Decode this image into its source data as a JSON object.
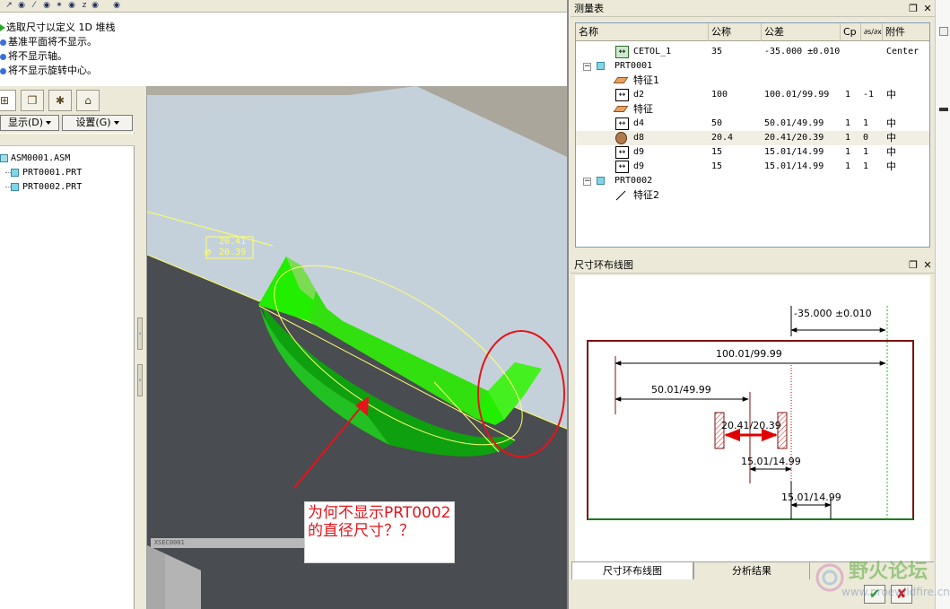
{
  "messages": [
    {
      "text": "选取尺寸以定义 1D 堆栈",
      "marker": "arrow"
    },
    {
      "text": "基准平面将不显示。",
      "marker": "bullet"
    },
    {
      "text": "将不显示轴。",
      "marker": "bullet"
    },
    {
      "text": "将不显示旋转中心。",
      "marker": "bullet"
    }
  ],
  "model_tree": {
    "show_menu": "显示(D)",
    "settings_menu": "设置(G)",
    "nodes": [
      "ASM0001.ASM",
      "PRT0001.PRT",
      "PRT0002.PRT"
    ]
  },
  "viewport": {
    "dim_upper": "20.41",
    "dim_lower": "20.39",
    "xsec_label": "XSEC0001",
    "note_text": "为何不显示PRT0002的直径尺寸？？"
  },
  "measure_table": {
    "title": "测量表",
    "columns": [
      "名称",
      "公称",
      "公差",
      "Cp",
      "∂s/∂x",
      "附件"
    ],
    "rows": [
      {
        "name": "CETOL_1",
        "nominal": "35",
        "tol": "-35.000 ±0.010",
        "cp": "",
        "sens": "",
        "attach": "Center",
        "icon": "dim-green",
        "indent": 1
      },
      {
        "name": "PRT0001",
        "nominal": "",
        "tol": "",
        "cp": "",
        "sens": "",
        "attach": "",
        "icon": "part",
        "indent": 0
      },
      {
        "name": "特征1",
        "nominal": "",
        "tol": "",
        "cp": "",
        "sens": "",
        "attach": "",
        "icon": "feature",
        "indent": 1
      },
      {
        "name": "d2",
        "nominal": "100",
        "tol": "100.01/99.99",
        "cp": "1",
        "sens": "-1",
        "attach": "中",
        "icon": "dim",
        "indent": 1
      },
      {
        "name": "特征",
        "nominal": "",
        "tol": "",
        "cp": "",
        "sens": "",
        "attach": "",
        "icon": "feature",
        "indent": 1
      },
      {
        "name": "d4",
        "nominal": "50",
        "tol": "50.01/49.99",
        "cp": "1",
        "sens": "1",
        "attach": "中",
        "icon": "dim",
        "indent": 1
      },
      {
        "name": "d8",
        "nominal": "20.4",
        "tol": "20.41/20.39",
        "cp": "1",
        "sens": "0",
        "attach": "中",
        "icon": "cylinder",
        "indent": 1
      },
      {
        "name": "d9",
        "nominal": "15",
        "tol": "15.01/14.99",
        "cp": "1",
        "sens": "1",
        "attach": "中",
        "icon": "dim",
        "indent": 1
      },
      {
        "name": "d9",
        "nominal": "15",
        "tol": "15.01/14.99",
        "cp": "1",
        "sens": "1",
        "attach": "中",
        "icon": "dim",
        "indent": 1
      },
      {
        "name": "PRT0002",
        "nominal": "",
        "tol": "",
        "cp": "",
        "sens": "",
        "attach": "",
        "icon": "part",
        "indent": 0
      },
      {
        "name": "特征2",
        "nominal": "",
        "tol": "",
        "cp": "",
        "sens": "",
        "attach": "",
        "icon": "line",
        "indent": 1
      }
    ]
  },
  "loop_diagram": {
    "title": "尺寸环布线图",
    "labels": {
      "total": "-35.000 ±0.010",
      "d2": "100.01/99.99",
      "d4": "50.01/49.99",
      "d8": "20.41/20.39",
      "d9a": "15.01/14.99",
      "d9b": "15.01/14.99"
    }
  },
  "bottom_tabs": [
    "尺寸环布线图",
    "分析结果"
  ],
  "window_buttons": {
    "restore": "❐",
    "close": "✕"
  },
  "watermark": {
    "text": "野火论坛",
    "url": "www.proewildfire.cn"
  },
  "colors": {
    "model_green": "#22ee00",
    "note_red": "#e4141a",
    "frame_dark_red": "#7a1414"
  }
}
